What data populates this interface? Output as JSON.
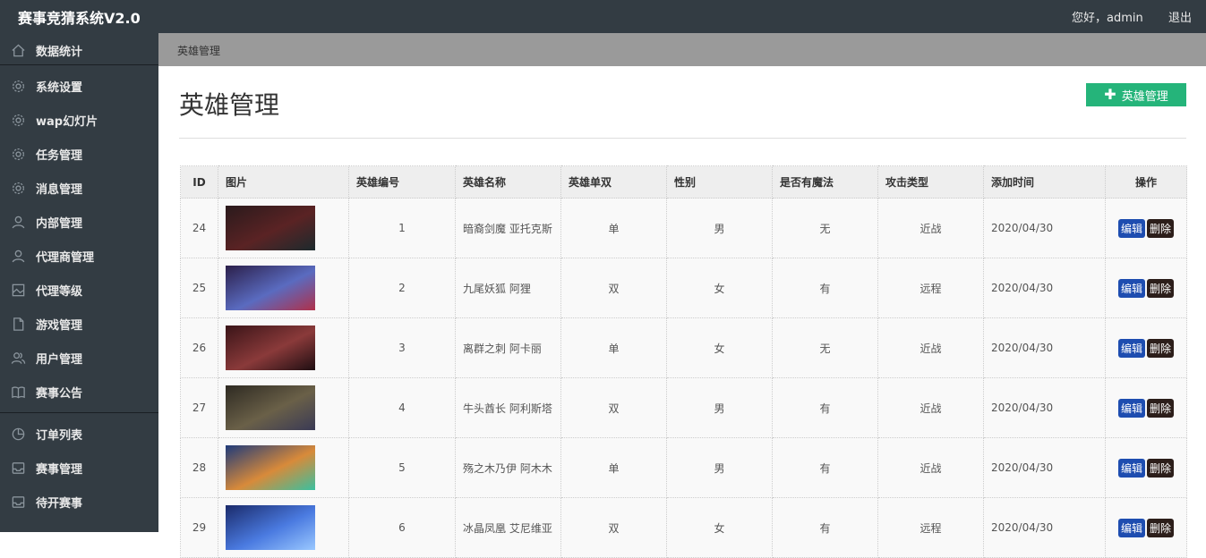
{
  "header": {
    "title": "赛事竞猜系统V2.0",
    "greeting": "您好，admin",
    "logout": "退出"
  },
  "sidebar": {
    "items": [
      {
        "label": "数据统计",
        "icon": "home-icon"
      },
      {
        "label": "系统设置",
        "icon": "gear-icon"
      },
      {
        "label": "wap幻灯片",
        "icon": "gear-icon"
      },
      {
        "label": "任务管理",
        "icon": "gear-icon"
      },
      {
        "label": "消息管理",
        "icon": "gear-icon"
      },
      {
        "label": "内部管理",
        "icon": "user-icon"
      },
      {
        "label": "代理商管理",
        "icon": "user-icon"
      },
      {
        "label": "代理等级",
        "icon": "picture-icon"
      },
      {
        "label": "游戏管理",
        "icon": "document-icon"
      },
      {
        "label": "用户管理",
        "icon": "users-icon"
      },
      {
        "label": "赛事公告",
        "icon": "book-icon"
      },
      {
        "label": "订单列表",
        "icon": "pie-chart-icon"
      },
      {
        "label": "赛事管理",
        "icon": "inbox-icon"
      },
      {
        "label": "待开赛事",
        "icon": "inbox-icon"
      }
    ]
  },
  "breadcrumb": "英雄管理",
  "page": {
    "title": "英雄管理",
    "add_button": "英雄管理"
  },
  "table": {
    "headers": {
      "id": "ID",
      "image": "图片",
      "number": "英雄编号",
      "name": "英雄名称",
      "single_double": "英雄单双",
      "gender": "性别",
      "magic": "是否有魔法",
      "attack": "攻击类型",
      "added": "添加时间",
      "ops": "操作"
    },
    "edit_label": "编辑",
    "delete_label": "删除",
    "rows": [
      {
        "id": "24",
        "number": "1",
        "name": "暗裔剑魔 亚托克斯",
        "single_double": "单",
        "gender": "男",
        "magic": "无",
        "attack": "近战",
        "added": "2020/04/30",
        "thumb_colors": [
          "#2a1a1c",
          "#5a2324",
          "#1c2a2d"
        ]
      },
      {
        "id": "25",
        "number": "2",
        "name": "九尾妖狐 阿狸",
        "single_double": "双",
        "gender": "女",
        "magic": "有",
        "attack": "远程",
        "added": "2020/04/30",
        "thumb_colors": [
          "#2b1f4a",
          "#5a6bc0",
          "#b0304a"
        ]
      },
      {
        "id": "26",
        "number": "3",
        "name": "离群之刺 阿卡丽",
        "single_double": "单",
        "gender": "女",
        "magic": "无",
        "attack": "近战",
        "added": "2020/04/30",
        "thumb_colors": [
          "#3a1418",
          "#8a3a3a",
          "#1f0e12"
        ]
      },
      {
        "id": "27",
        "number": "4",
        "name": "牛头酋长 阿利斯塔",
        "single_double": "双",
        "gender": "男",
        "magic": "有",
        "attack": "近战",
        "added": "2020/04/30",
        "thumb_colors": [
          "#2e2a22",
          "#6a6048",
          "#3a3a55"
        ]
      },
      {
        "id": "28",
        "number": "5",
        "name": "殇之木乃伊 阿木木",
        "single_double": "单",
        "gender": "男",
        "magic": "有",
        "attack": "近战",
        "added": "2020/04/30",
        "thumb_colors": [
          "#1e3a7a",
          "#d88a3a",
          "#3ac0a0"
        ]
      },
      {
        "id": "29",
        "number": "6",
        "name": "冰晶凤凰 艾尼维亚",
        "single_double": "双",
        "gender": "女",
        "magic": "有",
        "attack": "远程",
        "added": "2020/04/30",
        "thumb_colors": [
          "#1a2a6a",
          "#4a7ae0",
          "#9ac8ff"
        ]
      }
    ]
  }
}
